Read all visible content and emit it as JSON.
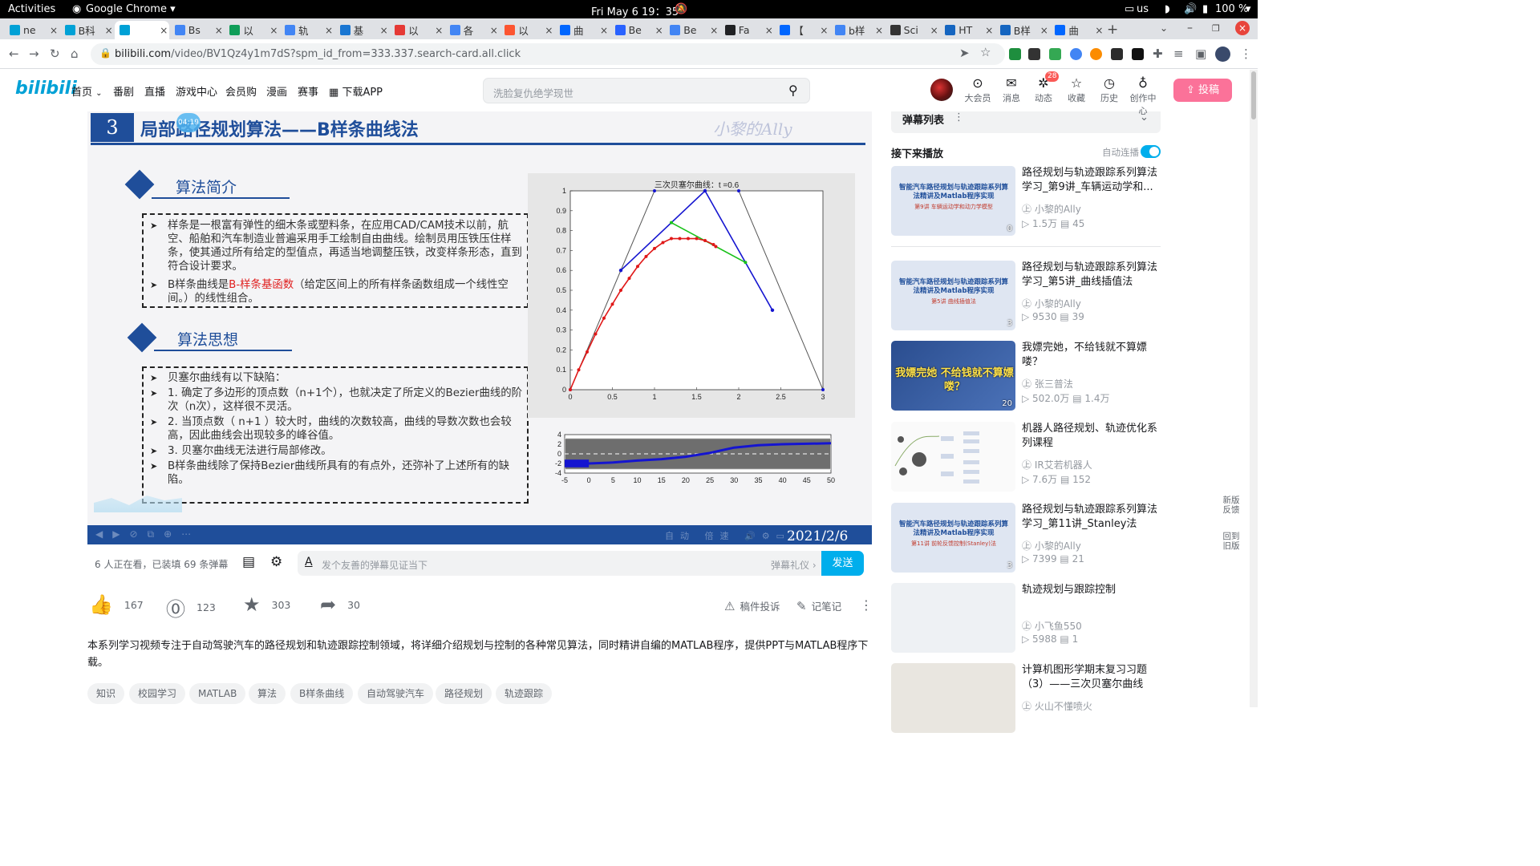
{
  "gnome": {
    "activities": "Activities",
    "app": "Google Chrome ▾",
    "clock": "Fri May 6  19：35",
    "lang": "us",
    "battery": "100 %"
  },
  "tabs": [
    {
      "label": "ne",
      "color": "#00a1d6"
    },
    {
      "label": "B科",
      "color": "#00a1d6"
    },
    {
      "label": "",
      "color": "#00a1d6"
    },
    {
      "label": "Bs",
      "color": "#4285f4"
    },
    {
      "label": "以",
      "color": "#0f9d58"
    },
    {
      "label": "轨",
      "color": "#4285f4"
    },
    {
      "label": "基",
      "color": "#1976d2"
    },
    {
      "label": "以",
      "color": "#e53935"
    },
    {
      "label": "各",
      "color": "#4285f4"
    },
    {
      "label": "以",
      "color": "#fc5531"
    },
    {
      "label": "曲",
      "color": "#0066ff"
    },
    {
      "label": "Be",
      "color": "#2962ff"
    },
    {
      "label": "Be",
      "color": "#4285f4"
    },
    {
      "label": "Fa",
      "color": "#202124"
    },
    {
      "label": "【",
      "color": "#0066ff"
    },
    {
      "label": "b样",
      "color": "#4285f4"
    },
    {
      "label": "Sci",
      "color": "#333333"
    },
    {
      "label": "HT",
      "color": "#1565c0"
    },
    {
      "label": "B样",
      "color": "#1565c0"
    },
    {
      "label": "曲",
      "color": "#0066ff"
    }
  ],
  "omnibox": {
    "host": "bilibili.com",
    "path": "/video/BV1Qz4y1m7dS?spm_id_from=333.337.search-card.all.click"
  },
  "header": {
    "logo": "bilibili",
    "nav": [
      "首页",
      "番剧",
      "直播",
      "游戏中心",
      "会员购",
      "漫画",
      "赛事",
      "下载APP"
    ],
    "search_placeholder": "洗脸复仇绝学现世",
    "icons": [
      {
        "label": "大会员",
        "glyph": "⊙"
      },
      {
        "label": "消息",
        "glyph": "✉"
      },
      {
        "label": "动态",
        "glyph": "✲",
        "badge": "28"
      },
      {
        "label": "收藏",
        "glyph": "☆"
      },
      {
        "label": "历史",
        "glyph": "◷"
      },
      {
        "label": "创作中心",
        "glyph": "♁"
      }
    ],
    "upload": "投稿"
  },
  "video": {
    "section_num": "3",
    "title": "局部路径规划算法——B样条曲线法",
    "time_badge": "04:19",
    "h1": "算法简介",
    "box1": {
      "p1": "样条是一根富有弹性的细木条或塑料条，在应用CAD/CAM技术以前，航空、船舶和汽车制造业普遍采用手工绘制自由曲线。绘制员用压铁压住样条，使其通过所有给定的型值点，再适当地调整压铁，改变样条形态，直到符合设计要求。",
      "p2a": "B样条曲线是",
      "p2b": "B-样条基函数",
      "p2c": "（给定区间上的所有样条函数组成一个线性空间。）的线性组合。"
    },
    "h2": "算法思想",
    "box2": [
      "贝塞尔曲线有以下缺陷：",
      "1. 确定了多边形的顶点数（n+1个），也就决定了所定义的Bezier曲线的阶次（n次），这样很不灵活。",
      "2. 当顶点数（ n+1 ）较大时，曲线的次数较高，曲线的导数次数也会较高，因此曲线会出现较多的峰谷值。",
      "3. 贝塞尔曲线无法进行局部修改。",
      "B样条曲线除了保持Bezier曲线所具有的有点外，还弥补了上述所有的缺陷。"
    ],
    "date": "2021/2/6"
  },
  "chart_data": [
    {
      "type": "line",
      "title": "三次贝塞尔曲线：t =0.6",
      "xlim": [
        0,
        3
      ],
      "ylim": [
        0,
        1
      ],
      "xticks": [
        "0",
        "0.5",
        "1",
        "1.5",
        "2",
        "2.5",
        "3"
      ],
      "yticks": [
        "0",
        "0.1",
        "0.2",
        "0.3",
        "0.4",
        "0.5",
        "0.6",
        "0.7",
        "0.8",
        "0.9",
        "1"
      ],
      "control_points": {
        "x": [
          0,
          1,
          2,
          3
        ],
        "y": [
          0,
          1,
          1,
          0
        ]
      },
      "level1": {
        "x": [
          0.6,
          1.6,
          2.4
        ],
        "y": [
          0.6,
          1.0,
          0.4
        ]
      },
      "level2": {
        "x": [
          1.2,
          2.08
        ],
        "y": [
          0.84,
          0.64
        ]
      },
      "curve": {
        "x": [
          0,
          0.1,
          0.2,
          0.3,
          0.4,
          0.5,
          0.6,
          0.7,
          0.8,
          0.9,
          1.0,
          1.1,
          1.2,
          1.3,
          1.4,
          1.5,
          1.6,
          1.7,
          1.728
        ],
        "y": [
          0,
          0.1,
          0.19,
          0.28,
          0.36,
          0.43,
          0.5,
          0.56,
          0.62,
          0.67,
          0.71,
          0.74,
          0.76,
          0.76,
          0.76,
          0.76,
          0.75,
          0.73,
          0.72
        ]
      }
    },
    {
      "type": "line",
      "xlim": [
        -5,
        50
      ],
      "ylim": [
        -4,
        4
      ],
      "xticks": [
        "-5",
        "0",
        "5",
        "10",
        "15",
        "20",
        "25",
        "30",
        "35",
        "40",
        "45",
        "50"
      ],
      "yticks": [
        "4",
        "2",
        "0",
        "-2",
        "-4"
      ],
      "path": {
        "x": [
          -5,
          0,
          5,
          10,
          15,
          20,
          25,
          30,
          35,
          40,
          45,
          50
        ],
        "y": [
          -2,
          -2,
          -1.8,
          -1.4,
          -1.1,
          -0.6,
          0.2,
          1.3,
          1.8,
          2.0,
          2.1,
          2.2
        ]
      }
    }
  ],
  "danmaku": {
    "viewers": "6 人正在看，已装填 69 条弹幕",
    "placeholder": "发个友善的弹幕见证当下",
    "etiquette": "弹幕礼仪 ›",
    "send": "发送"
  },
  "actions": {
    "like": "167",
    "coin": "123",
    "fav": "303",
    "share": "30",
    "report": "稿件投诉",
    "note": "记笔记"
  },
  "description": "本系列学习视频专注于自动驾驶汽车的路径规划和轨迹跟踪控制领域，将详细介绍规划与控制的各种常见算法，同时精讲自编的MATLAB程序，提供PPT与MATLAB程序下载。",
  "tags": [
    "知识",
    "校园学习",
    "MATLAB",
    "算法",
    "B样条曲线",
    "自动驾驶汽车",
    "路径规划",
    "轨迹跟踪"
  ],
  "sidebar": {
    "danmaku_list": "弹幕列表",
    "next_up": "接下来播放",
    "autoplay": "自动连播",
    "new_feedback": "新版反馈",
    "old_version": "回到旧版"
  },
  "recs": [
    {
      "title": "路径规划与轨迹跟踪系列算法学习_第9讲_车辆运动学和...",
      "up": "小黎的Ally",
      "views": "1.5万",
      "danmaku": "45",
      "thumb": "智能汽车路径规划与轨迹跟踪系列算法精讲及Matlab程序实现",
      "sub": "第9讲 车辆运动学和动力学模型",
      "dur": "0"
    },
    {
      "title": "路径规划与轨迹跟踪系列算法学习_第5讲_曲线插值法",
      "up": "小黎的Ally",
      "views": "9530",
      "danmaku": "39",
      "thumb": "智能汽车路径规划与轨迹跟踪系列算法精讲及Matlab程序实现",
      "sub": "第5讲 曲线插值法",
      "dur": "3"
    },
    {
      "title": "我嫖完她，不给钱就不算嫖喽？",
      "up": "张三普法",
      "views": "502.0万",
      "danmaku": "1.4万",
      "thumb": "我嫖完她 不给钱就不算嫖喽？",
      "sub": "",
      "dur": "20"
    },
    {
      "title": "机器人路径规划、轨迹优化系列课程",
      "up": "IR艾若机器人",
      "views": "7.6万",
      "danmaku": "152",
      "thumb": "",
      "sub": "",
      "dur": ""
    },
    {
      "title": "路径规划与轨迹跟踪系列算法学习_第11讲_Stanley法",
      "up": "小黎的Ally",
      "views": "7399",
      "danmaku": "21",
      "thumb": "智能汽车路径规划与轨迹跟踪系列算法精讲及Matlab程序实现",
      "sub": "第11讲 前轮反馈控制(Stanley)法",
      "dur": "3"
    },
    {
      "title": "轨迹规划与跟踪控制",
      "up": "小飞鱼550",
      "views": "5988",
      "danmaku": "1",
      "thumb": "",
      "sub": "",
      "dur": ""
    },
    {
      "title": "计算机图形学期末复习习题（3）——三次贝塞尔曲线",
      "up": "火山不懂喷火",
      "views": "",
      "danmaku": "",
      "thumb": "",
      "sub": "",
      "dur": ""
    }
  ]
}
